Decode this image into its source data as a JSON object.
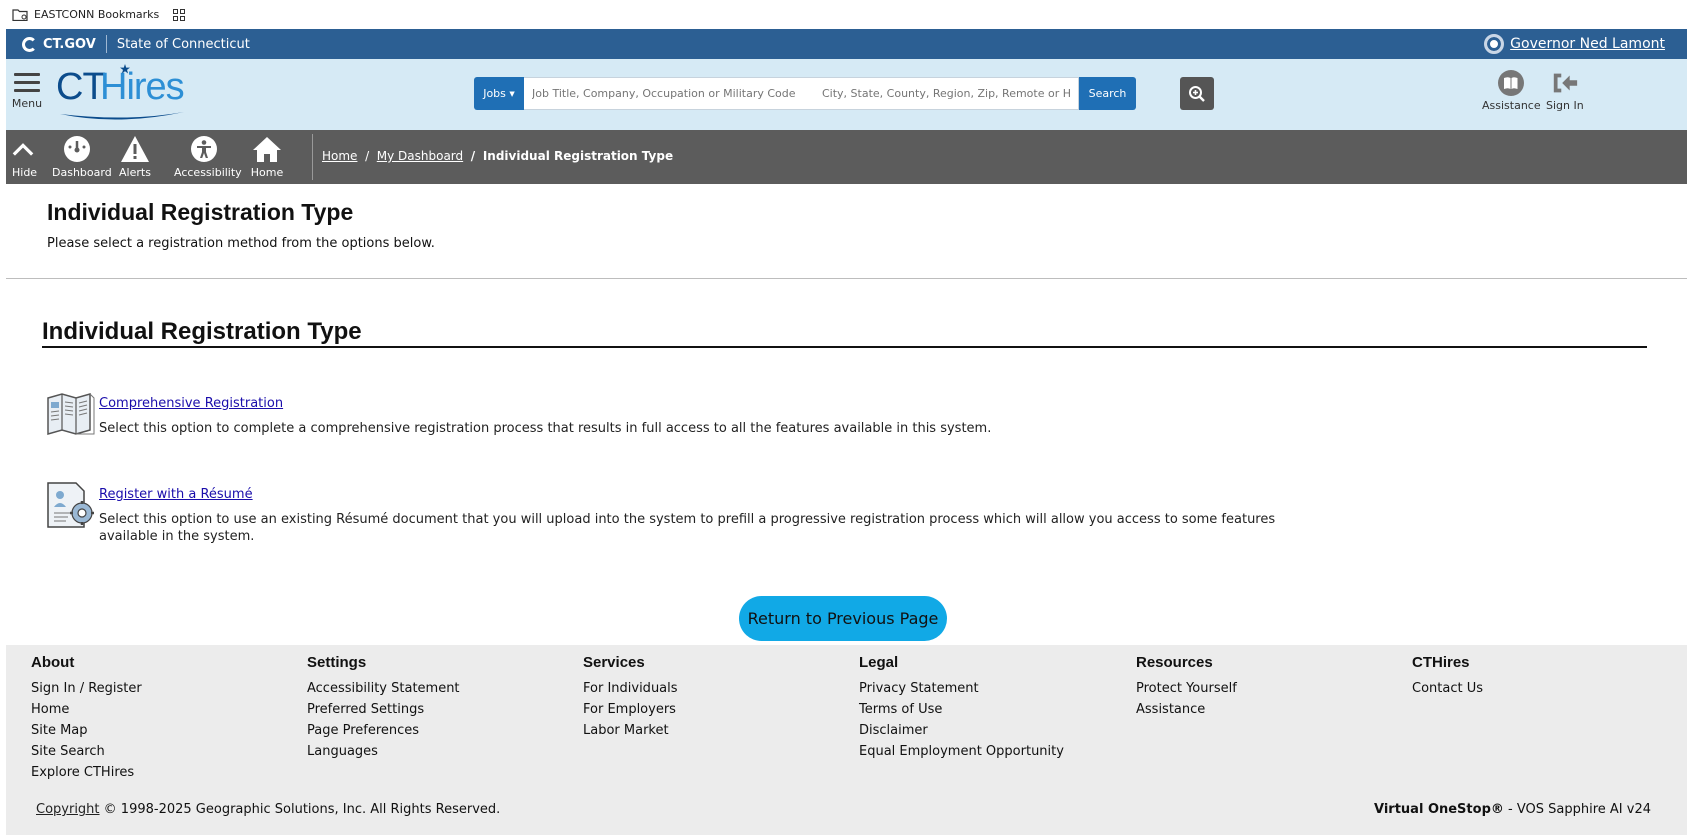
{
  "bookmarks": {
    "folder_label": "EASTCONN Bookmarks"
  },
  "ctbar": {
    "logo": "CT.GOV",
    "state": "State of Connecticut",
    "governor": "Governor Ned Lamont"
  },
  "header": {
    "menu_label": "Menu",
    "brand_ct": "CT",
    "brand_hires": "Hires",
    "jobs_label": "Jobs",
    "keyword_placeholder": "Job Title, Company, Occupation or Military Code",
    "location_placeholder": "City, State, County, Region, Zip, Remote or Hybrid",
    "search_label": "Search",
    "assistance_label": "Assistance",
    "signin_label": "Sign In"
  },
  "nav": {
    "hide": "Hide",
    "dashboard": "Dashboard",
    "alerts": "Alerts",
    "accessibility": "Accessibility",
    "home": "Home",
    "breadcrumb": {
      "home": "Home",
      "sep": "/",
      "dashboard": "My Dashboard",
      "current": "Individual Registration Type"
    }
  },
  "content": {
    "title": "Individual Registration Type",
    "subtitle": "Please select a registration method from the options below.",
    "section_title": "Individual Registration Type",
    "options": [
      {
        "label": "Comprehensive Registration",
        "desc": "Select this option to complete a comprehensive registration process that results in full access to all the features available in this system."
      },
      {
        "label": "Register with a Résumé",
        "desc": "Select this option to use an existing Résumé document that you will upload into the system to prefill a progressive registration process which will allow you access to some features available in the system."
      }
    ],
    "return_label": "Return to Previous Page"
  },
  "footer": {
    "columns": [
      {
        "title": "About",
        "links": [
          "Sign In / Register",
          "Home",
          "Site Map",
          "Site Search",
          "Explore CTHires"
        ]
      },
      {
        "title": "Settings",
        "links": [
          "Accessibility Statement",
          "Preferred Settings",
          "Page Preferences",
          "Languages"
        ]
      },
      {
        "title": "Services",
        "links": [
          "For Individuals",
          "For Employers",
          "Labor Market"
        ]
      },
      {
        "title": "Legal",
        "links": [
          "Privacy Statement",
          "Terms of Use",
          "Disclaimer",
          "Equal Employment Opportunity"
        ]
      },
      {
        "title": "Resources",
        "links": [
          "Protect Yourself",
          "Assistance"
        ]
      },
      {
        "title": "CTHires",
        "links": [
          "Contact Us"
        ]
      }
    ],
    "copyright_link": "Copyright",
    "copyright_text": "© 1998-2025 Geographic Solutions, Inc. All Rights Reserved.",
    "version_bold": "Virtual OneStop®",
    "version_text": "- VOS Sapphire AI v24"
  },
  "colors": {
    "ctbar": "#2c5f93",
    "header": "#d6eaf5",
    "navbar": "#5c5c5c",
    "accent": "#1f6fb5",
    "return_button": "#11a9e6",
    "footer": "#ececec"
  }
}
